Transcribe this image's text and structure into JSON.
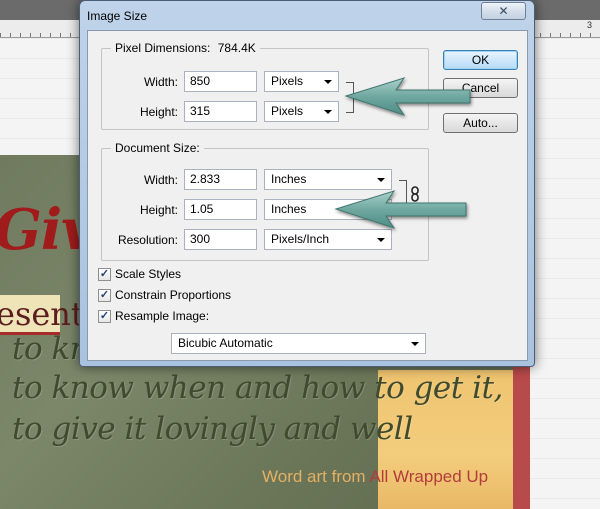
{
  "background": {
    "ruler_number": "3",
    "art": {
      "script_word": "Giv",
      "banner_word": "esent",
      "lines": [
        "to kn",
        "to know when and how to get it,",
        "to give it lovingly and well"
      ],
      "credit_prefix": "Word art from ",
      "credit_source": "All Wrapped Up"
    }
  },
  "dialog": {
    "title": "Image Size",
    "close_label": "✕",
    "pixel_dimensions": {
      "legend": "Pixel Dimensions:",
      "size": "784.4K",
      "width_label": "Width:",
      "width_value": "850",
      "width_unit": "Pixels",
      "height_label": "Height:",
      "height_value": "315",
      "height_unit": "Pixels"
    },
    "document_size": {
      "legend": "Document Size:",
      "width_label": "Width:",
      "width_value": "2.833",
      "width_unit": "Inches",
      "height_label": "Height:",
      "height_value": "1.05",
      "height_unit": "Inches",
      "resolution_label": "Resolution:",
      "resolution_value": "300",
      "resolution_unit": "Pixels/Inch"
    },
    "buttons": {
      "ok": "OK",
      "cancel": "Cancel",
      "auto": "Auto..."
    },
    "options": {
      "scale_styles": {
        "label": "Scale Styles",
        "checked": true
      },
      "constrain_proportions": {
        "label": "Constrain Proportions",
        "checked": true
      },
      "resample_image": {
        "label": "Resample Image:",
        "checked": true
      }
    },
    "resample_method": "Bicubic Automatic",
    "check_glyph": "✓",
    "chain_icon": "🔗"
  },
  "colors": {
    "annotation_arrow": "#6fa8a0",
    "dialog_frame": "#b4cae4",
    "art_red": "#a01c1c"
  }
}
